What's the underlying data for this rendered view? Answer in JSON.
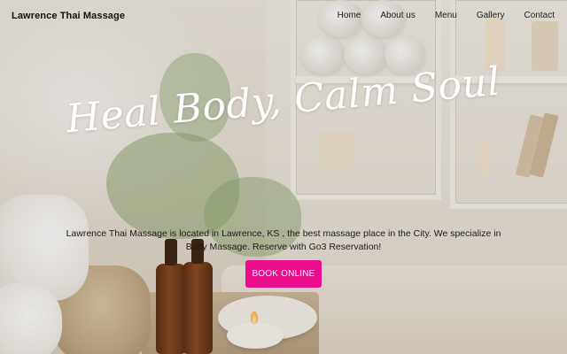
{
  "site": {
    "brand": "Lawrence Thai Massage"
  },
  "nav": {
    "items": [
      {
        "label": "Home"
      },
      {
        "label": "About us"
      },
      {
        "label": "Menu"
      },
      {
        "label": "Gallery"
      },
      {
        "label": "Contact"
      }
    ]
  },
  "hero": {
    "tagline": "Heal Body, Calm Soul",
    "intro": "Lawrence Thai Massage is located in Lawrence, KS , the best massage place in the City. We specialize in Body Massage. Reserve with Go3 Reservation!",
    "cta_label": "BOOK ONLINE"
  },
  "colors": {
    "accent": "#ea0d8c",
    "header_text": "#111111",
    "tagline": "#ffffff"
  }
}
